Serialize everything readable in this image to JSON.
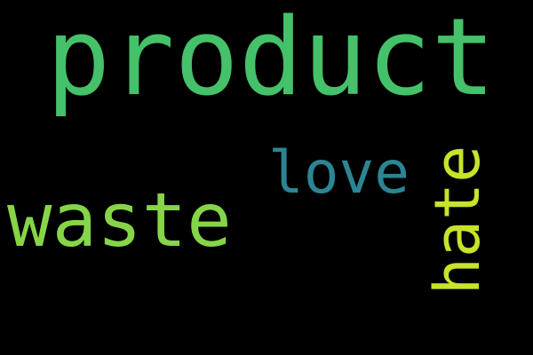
{
  "background": "#000000",
  "words": {
    "product": {
      "text": "product",
      "color": "#45c16a"
    },
    "waste": {
      "text": "waste",
      "color": "#86d549"
    },
    "love": {
      "text": "love",
      "color": "#2c8592"
    },
    "hate": {
      "text": "hate",
      "color": "#c9e22a"
    }
  }
}
